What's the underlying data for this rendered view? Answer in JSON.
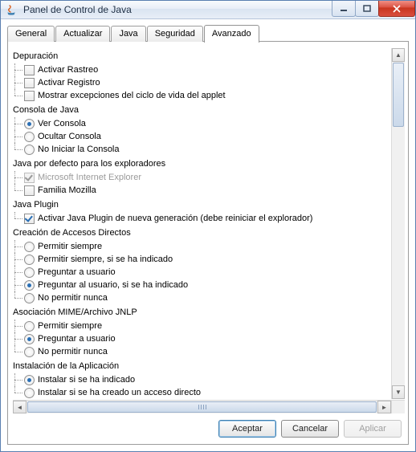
{
  "window": {
    "title": "Panel de Control de Java"
  },
  "tabs": {
    "general": "General",
    "actualizar": "Actualizar",
    "java": "Java",
    "seguridad": "Seguridad",
    "avanzado": "Avanzado"
  },
  "tree": {
    "depuracion": {
      "label": "Depuración",
      "activarRastreo": "Activar Rastreo",
      "activarRegistro": "Activar Registro",
      "mostrarExcepciones": "Mostrar excepciones del ciclo de vida del applet"
    },
    "consola": {
      "label": "Consola de Java",
      "ver": "Ver Consola",
      "ocultar": "Ocultar Consola",
      "noIniciar": "No Iniciar la Consola"
    },
    "javaDefecto": {
      "label": "Java por defecto para los exploradores",
      "ie": "Microsoft Internet Explorer",
      "mozilla": "Familia Mozilla"
    },
    "plugin": {
      "label": "Java Plugin",
      "activar": "Activar Java Plugin de nueva generación (debe reiniciar el explorador)"
    },
    "accesos": {
      "label": "Creación de Accesos Directos",
      "siempre": "Permitir siempre",
      "siempreIndicado": "Permitir siempre, si se ha indicado",
      "preguntar": "Preguntar a usuario",
      "preguntarIndicado": "Preguntar al usuario, si se ha indicado",
      "nunca": "No permitir nunca"
    },
    "mime": {
      "label": "Asociación MIME/Archivo JNLP",
      "siempre": "Permitir siempre",
      "preguntar": "Preguntar a usuario",
      "nunca": "No permitir nunca"
    },
    "instalacion": {
      "label": "Instalación de la Aplicación",
      "indicado": "Instalar si se ha indicado",
      "creado": "Instalar si se ha creado un acceso directo"
    }
  },
  "buttons": {
    "aceptar": "Aceptar",
    "cancelar": "Cancelar",
    "aplicar": "Aplicar"
  }
}
